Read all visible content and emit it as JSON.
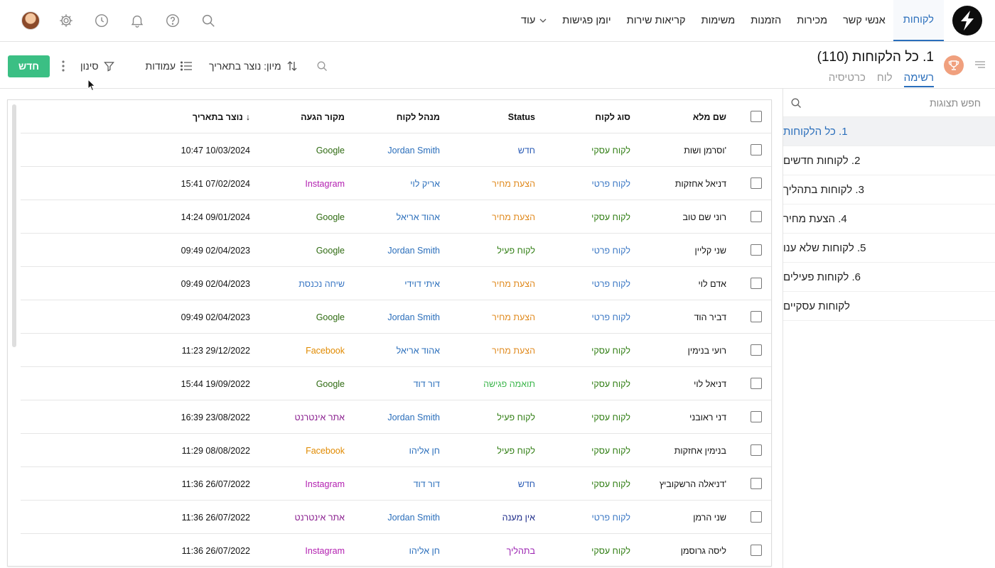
{
  "nav": {
    "items": [
      "לקוחות",
      "אנשי קשר",
      "מכירות",
      "הזמנות",
      "משימות",
      "קריאות שירות",
      "יומן פגישות"
    ],
    "more_label": "עוד"
  },
  "view": {
    "title": "1. כל הלקוחות (110)",
    "tabs": [
      "רשימה",
      "לוח",
      "כרטיסיה"
    ]
  },
  "toolbar": {
    "new_label": "חדש",
    "filter_label": "סינון",
    "columns_label": "עמודות",
    "sort_label": "מיון: נוצר בתאריך"
  },
  "sidebar": {
    "search_placeholder": "חפש תצוגות",
    "items": [
      "1. כל הלקוחות",
      "2. לקוחות חדשים",
      "3. לקוחות בתהליך",
      "4. הצעת מחיר",
      "5. לקוחות שלא ענו",
      "6. לקוחות פעילים",
      "לקוחות עסקיים"
    ]
  },
  "colors": {
    "accent": "#2a6ebb",
    "new_button": "#3bbf84",
    "type_business": "#2f7d12",
    "type_private": "#3a77c4",
    "status_new": "#2a5bb5",
    "status_quote": "#e08a1e",
    "status_active": "#2f7d12",
    "status_meeting": "#3ab54a",
    "status_noanswer": "#1f2d8a",
    "status_inprogress": "#9a1fb0",
    "src_google": "#2f6b12",
    "src_instagram": "#b21fb0",
    "src_facebook": "#e08a00",
    "src_walkin": "#3a77c4",
    "src_website": "#8a1f8f"
  },
  "table": {
    "headers": {
      "name": "שם מלא",
      "type": "סוג לקוח",
      "status": "Status",
      "manager": "מנהל לקוח",
      "source": "מקור הגעה",
      "created": "נוצר בתאריך"
    },
    "rows": [
      {
        "name": "וסרמן ושות'",
        "type": "לקוח עסקי",
        "type_color": "#2f7d12",
        "status": "חדש",
        "status_color": "#2a5bb5",
        "manager": "Jordan Smith",
        "source": "Google",
        "source_color": "#2f6b12",
        "created": "10:47 10/03/2024"
      },
      {
        "name": "דניאל אחזקות",
        "type": "לקוח פרטי",
        "type_color": "#3a77c4",
        "status": "הצעת מחיר",
        "status_color": "#e08a1e",
        "manager": "אריק לוי",
        "source": "Instagram",
        "source_color": "#b21fb0",
        "created": "15:41 07/02/2024"
      },
      {
        "name": "רוני שם טוב",
        "type": "לקוח עסקי",
        "type_color": "#2f7d12",
        "status": "הצעת מחיר",
        "status_color": "#e08a1e",
        "manager": "אהוד אריאל",
        "source": "Google",
        "source_color": "#2f6b12",
        "created": "14:24 09/01/2024"
      },
      {
        "name": "שני קליין",
        "type": "לקוח פרטי",
        "type_color": "#3a77c4",
        "status": "לקוח פעיל",
        "status_color": "#2f7d12",
        "manager": "Jordan Smith",
        "source": "Google",
        "source_color": "#2f6b12",
        "created": "09:49 02/04/2023"
      },
      {
        "name": "אדם לוי",
        "type": "לקוח פרטי",
        "type_color": "#3a77c4",
        "status": "הצעת מחיר",
        "status_color": "#e08a1e",
        "manager": "איתי דוידי",
        "source": "שיחה נכנסת",
        "source_color": "#3a77c4",
        "created": "09:49 02/04/2023"
      },
      {
        "name": "דביר הוד",
        "type": "לקוח פרטי",
        "type_color": "#3a77c4",
        "status": "הצעת מחיר",
        "status_color": "#e08a1e",
        "manager": "Jordan Smith",
        "source": "Google",
        "source_color": "#2f6b12",
        "created": "09:49 02/04/2023"
      },
      {
        "name": "רועי בנימין",
        "type": "לקוח עסקי",
        "type_color": "#2f7d12",
        "status": "הצעת מחיר",
        "status_color": "#e08a1e",
        "manager": "אהוד אריאל",
        "source": "Facebook",
        "source_color": "#e08a00",
        "created": "11:23 29/12/2022"
      },
      {
        "name": "דניאל לוי",
        "type": "לקוח עסקי",
        "type_color": "#2f7d12",
        "status": "תואמה פגישה",
        "status_color": "#3ab54a",
        "manager": "דור דוד",
        "source": "Google",
        "source_color": "#2f6b12",
        "created": "15:44 19/09/2022"
      },
      {
        "name": "דני ראובני",
        "type": "לקוח עסקי",
        "type_color": "#2f7d12",
        "status": "לקוח פעיל",
        "status_color": "#2f7d12",
        "manager": "Jordan Smith",
        "source": "אתר אינטרנט",
        "source_color": "#8a1f8f",
        "created": "16:39 23/08/2022"
      },
      {
        "name": "בנימין אחזקות",
        "type": "לקוח עסקי",
        "type_color": "#2f7d12",
        "status": "לקוח פעיל",
        "status_color": "#2f7d12",
        "manager": "חן אליהו",
        "source": "Facebook",
        "source_color": "#e08a00",
        "created": "11:29 08/08/2022"
      },
      {
        "name": "דניאלה הרשקוביץ'",
        "type": "לקוח עסקי",
        "type_color": "#2f7d12",
        "status": "חדש",
        "status_color": "#2a5bb5",
        "manager": "דור דוד",
        "source": "Instagram",
        "source_color": "#b21fb0",
        "created": "11:36 26/07/2022"
      },
      {
        "name": "שני הרמן",
        "type": "לקוח פרטי",
        "type_color": "#3a77c4",
        "status": "אין מענה",
        "status_color": "#1f2d8a",
        "manager": "Jordan Smith",
        "source": "אתר אינטרנט",
        "source_color": "#8a1f8f",
        "created": "11:36 26/07/2022"
      },
      {
        "name": "ליסה גרוסמן",
        "type": "לקוח עסקי",
        "type_color": "#2f7d12",
        "status": "בתהליך",
        "status_color": "#9a1fb0",
        "manager": "חן אליהו",
        "source": "Instagram",
        "source_color": "#b21fb0",
        "created": "11:36 26/07/2022"
      }
    ]
  }
}
